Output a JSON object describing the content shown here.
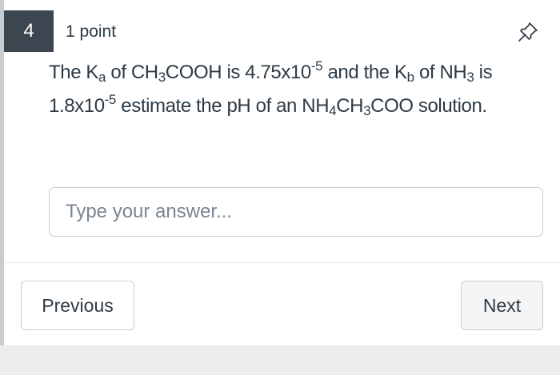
{
  "question": {
    "number": "4",
    "points": "1 point",
    "pin_icon": "pushpin-icon",
    "text": {
      "t1": "The K",
      "t2": "a",
      "t3": " of CH",
      "t4": "3",
      "t5": "COOH is 4.75x10",
      "t6": "-5",
      "t7": " and the K",
      "t8": "b",
      "t9": " of NH",
      "t10": "3",
      "t11": " is 1.8x10",
      "t12": "-5",
      "t13": " estimate the pH of an NH",
      "t14": "4",
      "t15": "CH",
      "t16": "3",
      "t17": "COO solution."
    }
  },
  "answer": {
    "value": "",
    "placeholder": "Type your answer..."
  },
  "navigation": {
    "previous_label": "Previous",
    "next_label": "Next"
  }
}
